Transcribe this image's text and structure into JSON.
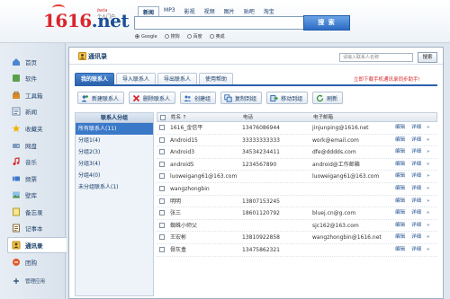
{
  "header": {
    "logo_num": "1616",
    "logo_tld": ".net",
    "logo_beta": "beta",
    "logo_sub": "个人门户",
    "search_tabs": [
      "新闻",
      "MP3",
      "影视",
      "视频",
      "图片",
      "贴吧",
      "淘宝"
    ],
    "active_search_tab": 0,
    "search_value": "",
    "search_button": "搜 索",
    "engines": [
      {
        "label": "Google",
        "selected": true
      },
      {
        "label": "搜狗",
        "selected": false
      },
      {
        "label": "百度",
        "selected": false
      },
      {
        "label": "奥成",
        "selected": false
      }
    ]
  },
  "sidebar": {
    "items": [
      {
        "label": "首页",
        "icon": "home-icon"
      },
      {
        "label": "软件",
        "icon": "software-icon"
      },
      {
        "label": "工具箱",
        "icon": "toolbox-icon"
      },
      {
        "label": "新闻",
        "icon": "news-icon"
      },
      {
        "label": "收藏夹",
        "icon": "favorites-icon"
      },
      {
        "label": "网盘",
        "icon": "netdisk-icon"
      },
      {
        "label": "音乐",
        "icon": "music-icon"
      },
      {
        "label": "频票",
        "icon": "ticket-icon"
      },
      {
        "label": "壁库",
        "icon": "wallpaper-icon"
      },
      {
        "label": "备忘录",
        "icon": "memo-icon"
      },
      {
        "label": "记事本",
        "icon": "notepad-icon"
      },
      {
        "label": "通讯录",
        "icon": "contacts-icon"
      },
      {
        "label": "团购",
        "icon": "groupbuy-icon"
      }
    ],
    "active_index": 11,
    "manage_label": "管理应用"
  },
  "main": {
    "title": "通讯录",
    "contact_search_placeholder": "请输入联系人名称",
    "search_button": "搜索",
    "tabs": [
      "我的联系人",
      "导入联系人",
      "导出联系人",
      "使用帮助"
    ],
    "active_tab": 0,
    "help_link": "立即下载手机通讯录同步助手!",
    "toolbar": [
      {
        "label": "新建联系人",
        "icon": "add-contact-icon"
      },
      {
        "label": "删除联系人",
        "icon": "delete-contact-icon"
      },
      {
        "label": "创建组",
        "icon": "create-group-icon"
      },
      {
        "label": "复制到组",
        "icon": "copy-to-group-icon"
      },
      {
        "label": "移动到组",
        "icon": "move-to-group-icon"
      },
      {
        "label": "刷新",
        "icon": "refresh-icon"
      }
    ],
    "groups": {
      "header": "联系人分组",
      "items": [
        "所有联系人(11)",
        "分组1(4)",
        "分组2(3)",
        "分组3(4)",
        "分组4(0)",
        "未分组联系人(1)"
      ],
      "active_index": 0
    },
    "table": {
      "columns": [
        "姓名 ↑",
        "电话",
        "电子邮箱"
      ],
      "rows": [
        {
          "name": "1616_金信平",
          "phone": "13476086944",
          "email": "jinjunping@1616.net"
        },
        {
          "name": "Android15",
          "phone": "33333333333",
          "email": "work@email.com"
        },
        {
          "name": "Android3",
          "phone": "34534234411",
          "email": "dfe@dddds.com"
        },
        {
          "name": "android5",
          "phone": "1234567890",
          "email": "android@工作邮箱"
        },
        {
          "name": "luoweigang61@163.com",
          "phone": "",
          "email": "luoweigang61@163.com"
        },
        {
          "name": "wangzhongbin",
          "phone": "",
          "email": ""
        },
        {
          "name": "明明",
          "phone": "13807153245",
          "email": ""
        },
        {
          "name": "张三",
          "phone": "18601120792",
          "email": "bluej.cn@g.com"
        },
        {
          "name": "蜘蛛小师父",
          "phone": "",
          "email": "sjc162@163.com"
        },
        {
          "name": "王宏彬",
          "phone": "13810922858",
          "email": "wangzhongbin@1616.net"
        },
        {
          "name": "骨灰盒",
          "phone": "13475862321",
          "email": ""
        }
      ],
      "edit_label": "编辑",
      "detail_label": "详细",
      "detail_arrow": "»"
    }
  }
}
